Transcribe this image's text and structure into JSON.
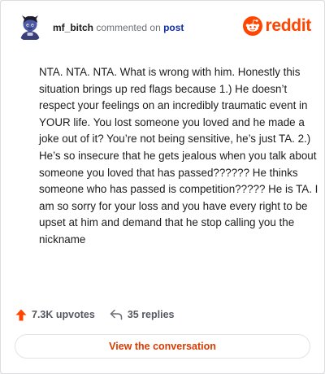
{
  "header": {
    "username": "mf_bitch",
    "action_text": "commented on",
    "target_text": "post",
    "brand": "reddit"
  },
  "comment": {
    "body": "NTA. NTA. NTA. What is wrong with him. Honestly this situation brings up red flags because 1.) He doesn’t respect your feelings on an incredibly traumatic event in YOUR life. You lost someone you loved and he made a joke out of it? You’re not being sensitive, he’s just TA. 2.) He’s so insecure that he gets jealous when you talk about someone you loved that has passed?????? He thinks someone who has passed is competition????? He is TA. I am so sorry for your loss and you have every right to be upset at him and demand that he stop calling you the nickname"
  },
  "actions": {
    "upvotes": "7.3K upvotes",
    "replies": "35 replies",
    "upvote_icon": "upvote-arrow-icon",
    "reply_icon": "reply-arrow-icon"
  },
  "cta": {
    "label": "View the conversation"
  },
  "colors": {
    "brand_orange": "#ff4500",
    "link_blue": "#0f2fa8",
    "cta_text": "#d93a00",
    "text": "#1c1c1c",
    "muted": "#6b6f74"
  }
}
